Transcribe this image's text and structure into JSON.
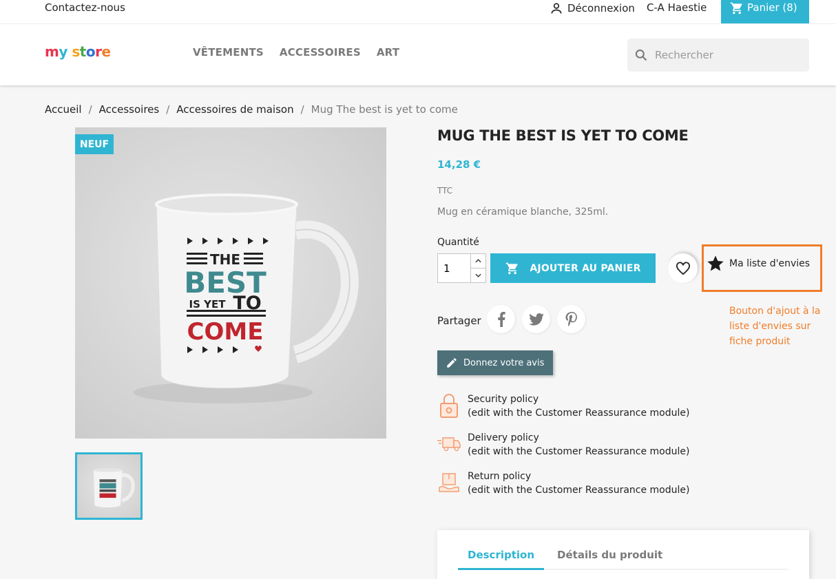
{
  "topbar": {
    "contact": "Contactez-nous",
    "logout": "Déconnexion",
    "username": "C-A Haestie",
    "cart": "Panier (8)"
  },
  "header": {
    "logo": "my store",
    "nav": [
      "VÊTEMENTS",
      "ACCESSOIRES",
      "ART"
    ],
    "search_placeholder": "Rechercher"
  },
  "breadcrumb": [
    "Accueil",
    "Accessoires",
    "Accessoires de maison",
    "Mug The best is yet to come"
  ],
  "product": {
    "badge": "NEUF",
    "mug_text": {
      "line1": "THE",
      "line2": "BEST",
      "line3a": "IS YET",
      "line3b": "TO",
      "line4": "COME"
    },
    "title": "MUG THE BEST IS YET TO COME",
    "price": "14,28 €",
    "tax": "TTC",
    "description": "Mug en céramique blanche, 325ml.",
    "quantity_label": "Quantité",
    "quantity_value": "1",
    "add_to_cart": "AJOUTER AU PANIER",
    "wishlist_label": "Ma liste d'envies",
    "annotation": "Bouton d'ajout à la liste d'envies sur fiche produit",
    "share_label": "Partager",
    "review_button": "Donnez votre avis"
  },
  "reassurance": [
    {
      "title": "Security policy",
      "subtitle": "(edit with the Customer Reassurance module)",
      "icon": "lock-icon"
    },
    {
      "title": "Delivery policy",
      "subtitle": "(edit with the Customer Reassurance module)",
      "icon": "truck-icon"
    },
    {
      "title": "Return policy",
      "subtitle": "(edit with the Customer Reassurance module)",
      "icon": "box-return-icon"
    }
  ],
  "tabs": [
    "Description",
    "Détails du produit"
  ],
  "colors": {
    "accent": "#2fb5d2",
    "annotation": "#f07d2a",
    "review_button": "#4d7079"
  }
}
